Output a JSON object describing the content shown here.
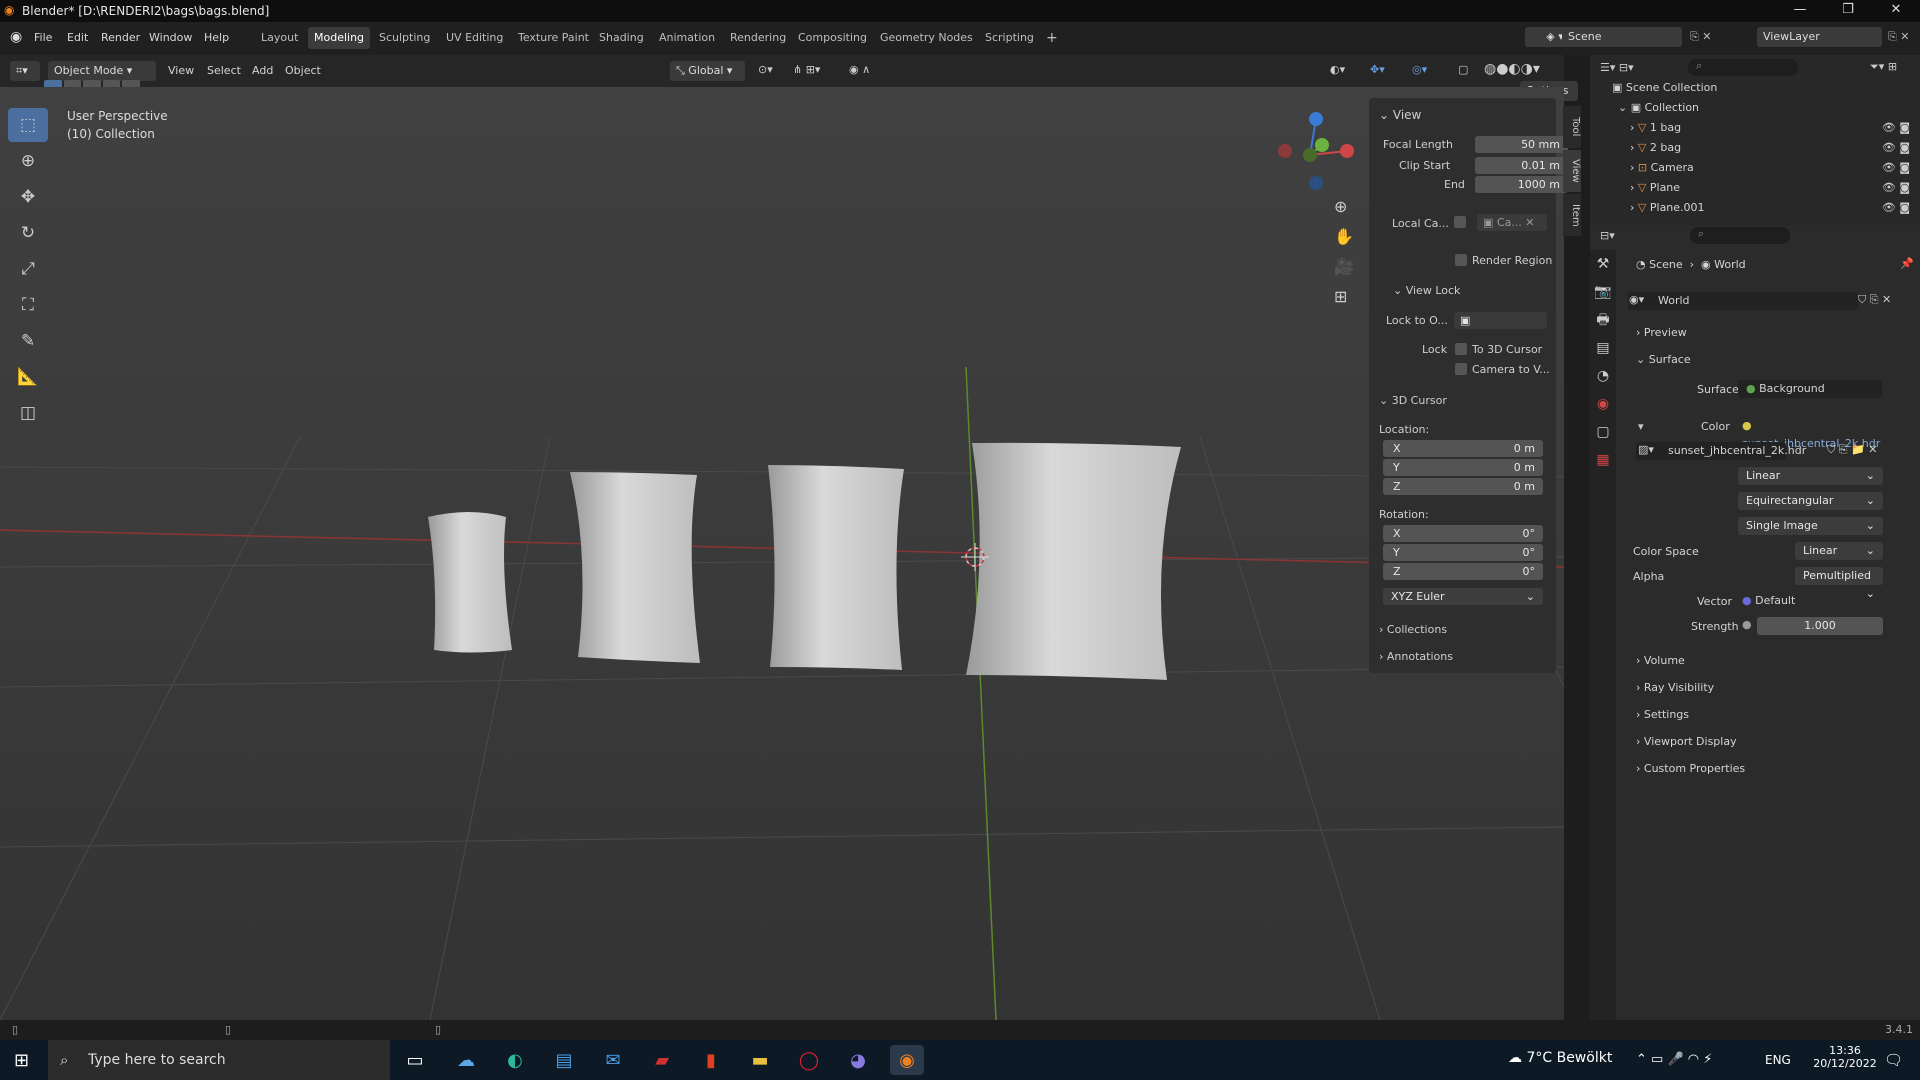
{
  "window": {
    "title": "Blender* [D:\\RENDERI2\\bags\\bags.blend]"
  },
  "menu": [
    "File",
    "Edit",
    "Render",
    "Window",
    "Help"
  ],
  "workspaces": [
    "Layout",
    "Modeling",
    "Sculpting",
    "UV Editing",
    "Texture Paint",
    "Shading",
    "Animation",
    "Rendering",
    "Compositing",
    "Geometry Nodes",
    "Scripting"
  ],
  "scene": {
    "label": "Scene",
    "viewlayer": "ViewLayer"
  },
  "header": {
    "mode": "Object Mode",
    "view": "View",
    "select": "Select",
    "add": "Add",
    "object": "Object",
    "orientation": "Global",
    "options": "Options"
  },
  "viewport": {
    "perspective": "User Perspective",
    "collection": "(10) Collection"
  },
  "npanel": {
    "view_title": "View",
    "focal_label": "Focal Length",
    "focal_value": "50 mm",
    "clip_start_label": "Clip Start",
    "clip_start_value": "0.01 m",
    "clip_end_label": "End",
    "clip_end_value": "1000 m",
    "local_camera_label": "Local Ca...",
    "local_camera_value": "Ca...",
    "render_region": "Render Region",
    "view_lock_title": "View Lock",
    "lock_to_label": "Lock to O...",
    "lock_label": "Lock",
    "lock_3d_cursor": "To 3D Cursor",
    "camera_to_view": "Camera to V...",
    "cursor_title": "3D Cursor",
    "location_label": "Location:",
    "loc_x_label": "X",
    "loc_x": "0 m",
    "loc_y_label": "Y",
    "loc_y": "0 m",
    "loc_z_label": "Z",
    "loc_z": "0 m",
    "rotation_label": "Rotation:",
    "rot_x_label": "X",
    "rot_x": "0°",
    "rot_y_label": "Y",
    "rot_y": "0°",
    "rot_z_label": "Z",
    "rot_z": "0°",
    "rot_mode": "XYZ Euler",
    "collections": "Collections",
    "annotations": "Annotations",
    "tabs": [
      "Tool",
      "View",
      "Item"
    ]
  },
  "outliner": {
    "root": "Scene Collection",
    "collection": "Collection",
    "items": [
      "1 bag",
      "2 bag",
      "Camera",
      "Plane",
      "Plane.001"
    ]
  },
  "properties": {
    "breadcrumb_scene": "Scene",
    "breadcrumb_world": "World",
    "world_name": "World",
    "preview": "Preview",
    "surface_section": "Surface",
    "surface_label": "Surface",
    "surface_value": "Background",
    "color_label": "Color",
    "color_value": "sunset_jhbcentral_2k.hdr",
    "image_name": "sunset_jhbcentral_2k.hdr",
    "interp": "Linear",
    "projection": "Equirectangular",
    "source": "Single Image",
    "colorspace_label": "Color Space",
    "colorspace_value": "Linear",
    "alpha_label": "Alpha",
    "alpha_value": "Pemultiplied",
    "vector_label": "Vector",
    "vector_value": "Default",
    "strength_label": "Strength",
    "strength_value": "1.000",
    "sections": [
      "Volume",
      "Ray Visibility",
      "Settings",
      "Viewport Display",
      "Custom Properties"
    ]
  },
  "status": {
    "version": "3.4.1"
  },
  "taskbar": {
    "search_placeholder": "Type here to search",
    "weather": "7°C  Bewölkt",
    "lang": "ENG",
    "time": "13:36",
    "date": "20/12/2022"
  }
}
